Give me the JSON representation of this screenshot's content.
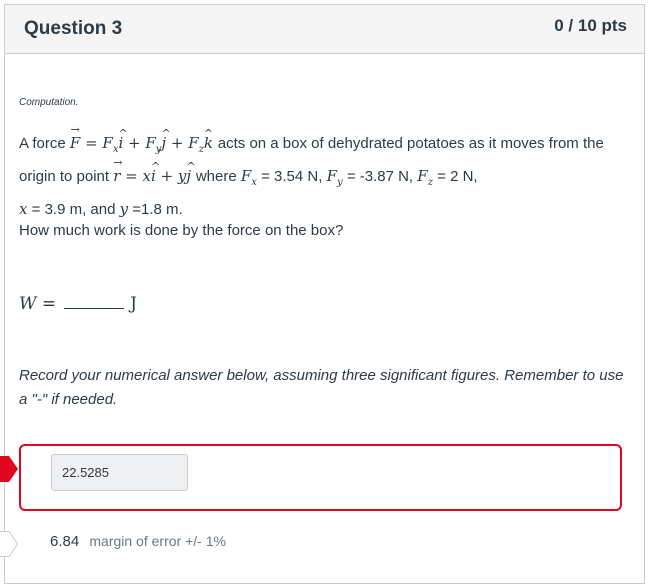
{
  "question": {
    "title": "Question 3",
    "points": "0 / 10 pts"
  },
  "tag": "Computation.",
  "problem": {
    "p1_a": "A force",
    "p1_b": "acts on a box of dehydrated potatoes as it moves from the origin to point",
    "p1_c": "where",
    "Fx_val": "= 3.54 N,",
    "Fy_val": "= -3.87 N,",
    "Fz_val": "= 2 N,",
    "x_val": "= 3.9 m, and",
    "y_val": "=1.8 m."
  },
  "question_text": "How much work is done by the force on the box?",
  "equation": {
    "lhs": "W =",
    "unit": "J"
  },
  "instructions": "Record your numerical answer below, assuming three significant figures. Remember to use a \"-\" if needed.",
  "answer": {
    "submitted_value": "22.5285",
    "correct_value": "6.84",
    "margin_text": "margin of error +/- 1%"
  },
  "colors": {
    "wrong": "#e0061f",
    "border": "#c7cdd1",
    "header_bg": "#f5f5f5"
  }
}
